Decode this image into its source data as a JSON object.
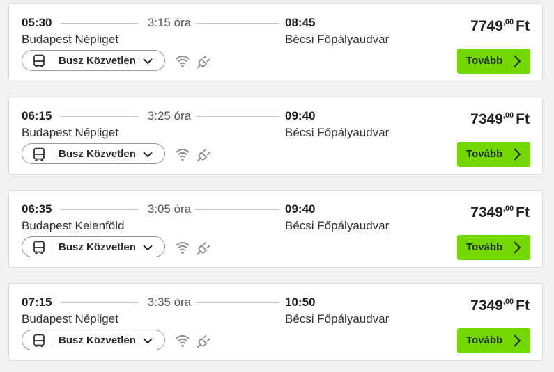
{
  "common": {
    "transport_label": "Busz Közvetlen",
    "next_label": "Tovább",
    "currency": "Ft",
    "icons": [
      "bus-icon",
      "chevron-down-icon",
      "wifi-icon",
      "power-plug-icon",
      "chevron-right-icon"
    ],
    "colors": {
      "accent": "#73d700",
      "background": "#f1f2f2",
      "card": "#ffffff"
    }
  },
  "rides": [
    {
      "departure_time": "05:30",
      "duration": "3:15 óra",
      "arrival_time": "08:45",
      "departure_station": "Budapest Népliget",
      "arrival_station": "Bécsi Főpályaudvar",
      "price_main": "7749",
      "price_cents": ",00"
    },
    {
      "departure_time": "06:15",
      "duration": "3:25 óra",
      "arrival_time": "09:40",
      "departure_station": "Budapest Népliget",
      "arrival_station": "Bécsi Főpályaudvar",
      "price_main": "7349",
      "price_cents": ",00"
    },
    {
      "departure_time": "06:35",
      "duration": "3:05 óra",
      "arrival_time": "09:40",
      "departure_station": "Budapest Kelenföld",
      "arrival_station": "Bécsi Főpályaudvar",
      "price_main": "7349",
      "price_cents": ",00"
    },
    {
      "departure_time": "07:15",
      "duration": "3:35 óra",
      "arrival_time": "10:50",
      "departure_station": "Budapest Népliget",
      "arrival_station": "Bécsi Főpályaudvar",
      "price_main": "7349",
      "price_cents": ",00"
    }
  ]
}
